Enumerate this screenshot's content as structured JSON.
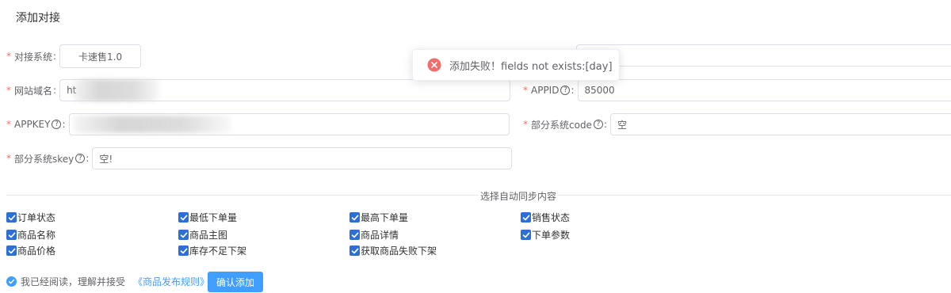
{
  "page": {
    "title": "添加对接"
  },
  "form": {
    "system": {
      "label": "对接系统",
      "value": "卡速售1.0"
    },
    "domain": {
      "label": "网站域名",
      "value": "ht"
    },
    "appid": {
      "label": "APPID",
      "value": "85000"
    },
    "appkey": {
      "label": "APPKEY",
      "value": ""
    },
    "code": {
      "label": "部分系统code",
      "value": "空"
    },
    "skey": {
      "label": "部分系统skey",
      "value": "空!"
    },
    "colon": ":",
    "required_mark": "*",
    "help_glyph": "?"
  },
  "sync": {
    "title": "选择自动同步内容",
    "items": [
      {
        "label": "订单状态",
        "checked": true
      },
      {
        "label": "最低下单量",
        "checked": true
      },
      {
        "label": "最高下单量",
        "checked": true
      },
      {
        "label": "销售状态",
        "checked": true
      },
      {
        "label": "商品名称",
        "checked": true
      },
      {
        "label": "商品主图",
        "checked": true
      },
      {
        "label": "商品详情",
        "checked": true
      },
      {
        "label": "下单参数",
        "checked": true
      },
      {
        "label": "商品价格",
        "checked": true
      },
      {
        "label": "库存不足下架",
        "checked": true
      },
      {
        "label": "获取商品失败下架",
        "checked": true
      }
    ]
  },
  "agreement": {
    "text": "我已经阅读，理解并接受",
    "link": "《商品发布规则》",
    "checked": true
  },
  "submit": {
    "label": "确认添加"
  },
  "toast": {
    "message": "添加失败！fields not exists:[day]"
  },
  "colors": {
    "primary": "#409eff",
    "danger": "#f56c6c",
    "checkbox": "#2d6fd6"
  }
}
